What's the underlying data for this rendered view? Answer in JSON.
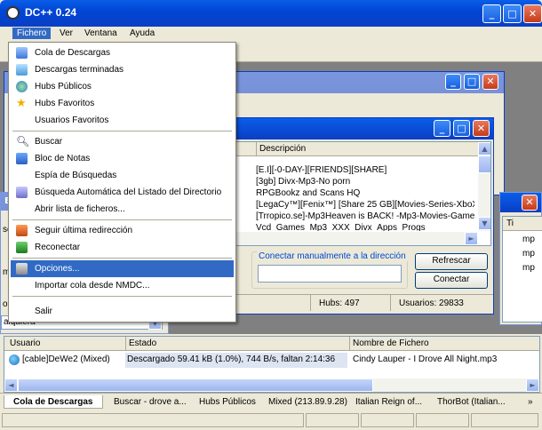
{
  "app": {
    "title": "DC++ 0.24"
  },
  "menubar": [
    "Fichero",
    "Ver",
    "Ventana",
    "Ayuda"
  ],
  "fichero_menu": [
    {
      "label": "Cola de Descargas",
      "icon": "queue-icon"
    },
    {
      "label": "Descargas terminadas",
      "icon": "finished-downloads-icon"
    },
    {
      "label": "Hubs Públicos",
      "icon": "globe-icon"
    },
    {
      "label": "Hubs Favoritos",
      "icon": "star-icon"
    },
    {
      "label": "Usuarios Favoritos",
      "icon": ""
    },
    {
      "label": "Buscar",
      "icon": "search-icon"
    },
    {
      "label": "Bloc de Notas",
      "icon": "notepad-icon"
    },
    {
      "label": "Espía de Búsquedas",
      "icon": ""
    },
    {
      "label": "Búsqueda Automática del Listado del Directorio",
      "icon": "auto-search-icon"
    },
    {
      "label": "Abrir lista de ficheros...",
      "icon": ""
    },
    {
      "label": "Seguir última redirección",
      "icon": "redirect-icon"
    },
    {
      "label": "Reconectar",
      "icon": "reconnect-icon"
    },
    {
      "label": "Opciones...",
      "icon": "options-icon"
    },
    {
      "label": "Importar cola desde NMDC...",
      "icon": ""
    },
    {
      "label": "Salir",
      "icon": ""
    }
  ],
  "hubs_window": {
    "column_descripcion": "Descripción",
    "rows": [
      "[E.I][-0-DAY-][FRIENDS][SHARE]",
      "[3gb] Divx-Mp3-No porn",
      "RPGBookz and Scans HQ",
      "[LegaCy™][Fenix™] [Share 25 GB][Movies-Series-XboX...",
      "[Trropico.se]-Mp3Heaven is BACK! -Mp3-Movies-Games",
      "Vcd_Games_Mp3_XXX_Divx_Apps_Progs"
    ],
    "manual_connect_label": "Conectar manualmente a la dirección",
    "manual_connect_value": "",
    "refresh_button": "Refrescar",
    "connect_button": "Conectar",
    "hubs_count": "Hubs: 497",
    "users_count": "Usuarios: 29833"
  },
  "side_fragments": {
    "left_a": "Bi",
    "left_b": "sc",
    "left_c": "ma",
    "left_d": "o",
    "left_combo": "alquiera",
    "right_col": "Ti",
    "right_rows": [
      "mp",
      "mp",
      "mp"
    ]
  },
  "transfers": {
    "columns": [
      "Usuario",
      "Estado",
      "Nombre de Fichero"
    ],
    "rows": [
      {
        "user": "[cable]DeWe2 (Mixed)",
        "status": "Descargado 59.41 kB (1.0%), 744 B/s, faltan 2:14:36",
        "file": "Cindy Lauper - I Drove All Night.mp3"
      }
    ]
  },
  "tabs": [
    "Cola de Descargas",
    "Buscar - drove a...",
    "Hubs Públicos",
    "Mixed (213.89.9.28)",
    "Italian Reign of...",
    "ThorBot (Italian..."
  ],
  "tabs_overflow": "»",
  "colors": {
    "titlebar": "#0a5ee8",
    "highlight": "#316ac5",
    "face": "#ece9d8"
  }
}
